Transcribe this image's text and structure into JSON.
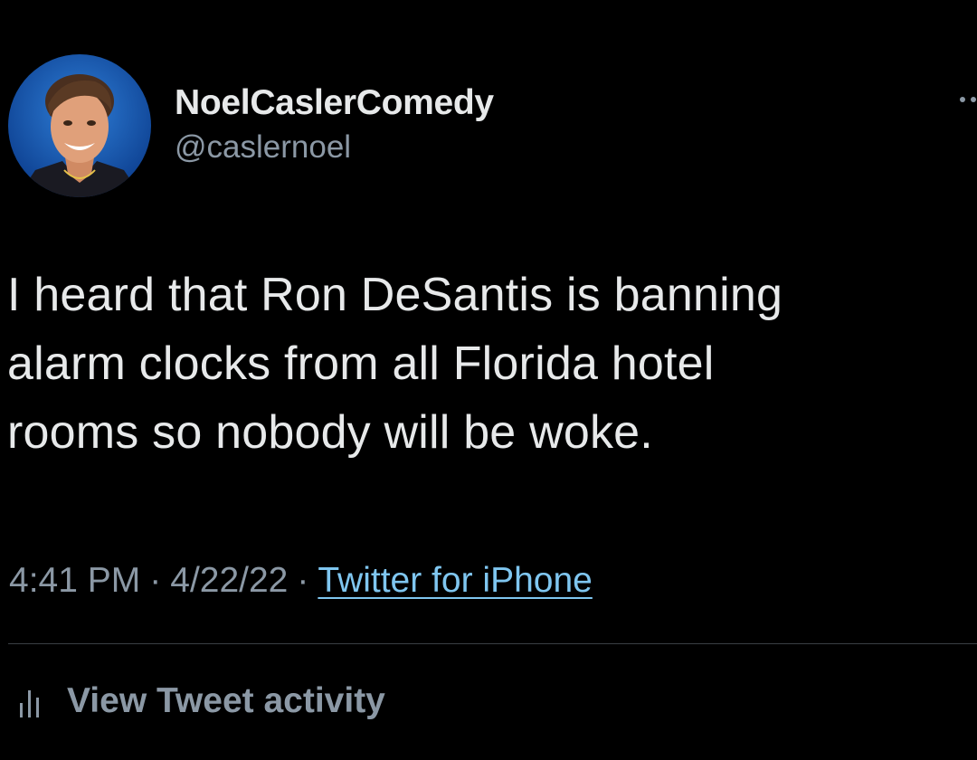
{
  "user": {
    "display_name": "NoelCaslerComedy",
    "handle": "@caslernoel",
    "avatar": "profile-photo"
  },
  "tweet": {
    "lines": [
      "I heard that Ron DeSantis is banning",
      "alarm clocks from all Florida hotel",
      "rooms so nobody will be woke."
    ]
  },
  "meta": {
    "time": "4:41 PM",
    "separator": "·",
    "date": "4/22/22",
    "source": "Twitter for iPhone"
  },
  "activity": {
    "label": "View Tweet activity",
    "icon": "bar-chart-icon"
  },
  "colors": {
    "background": "#000000",
    "primary_text": "#e7e9ea",
    "secondary_text": "#8b98a5",
    "link": "#7fc6f0"
  }
}
